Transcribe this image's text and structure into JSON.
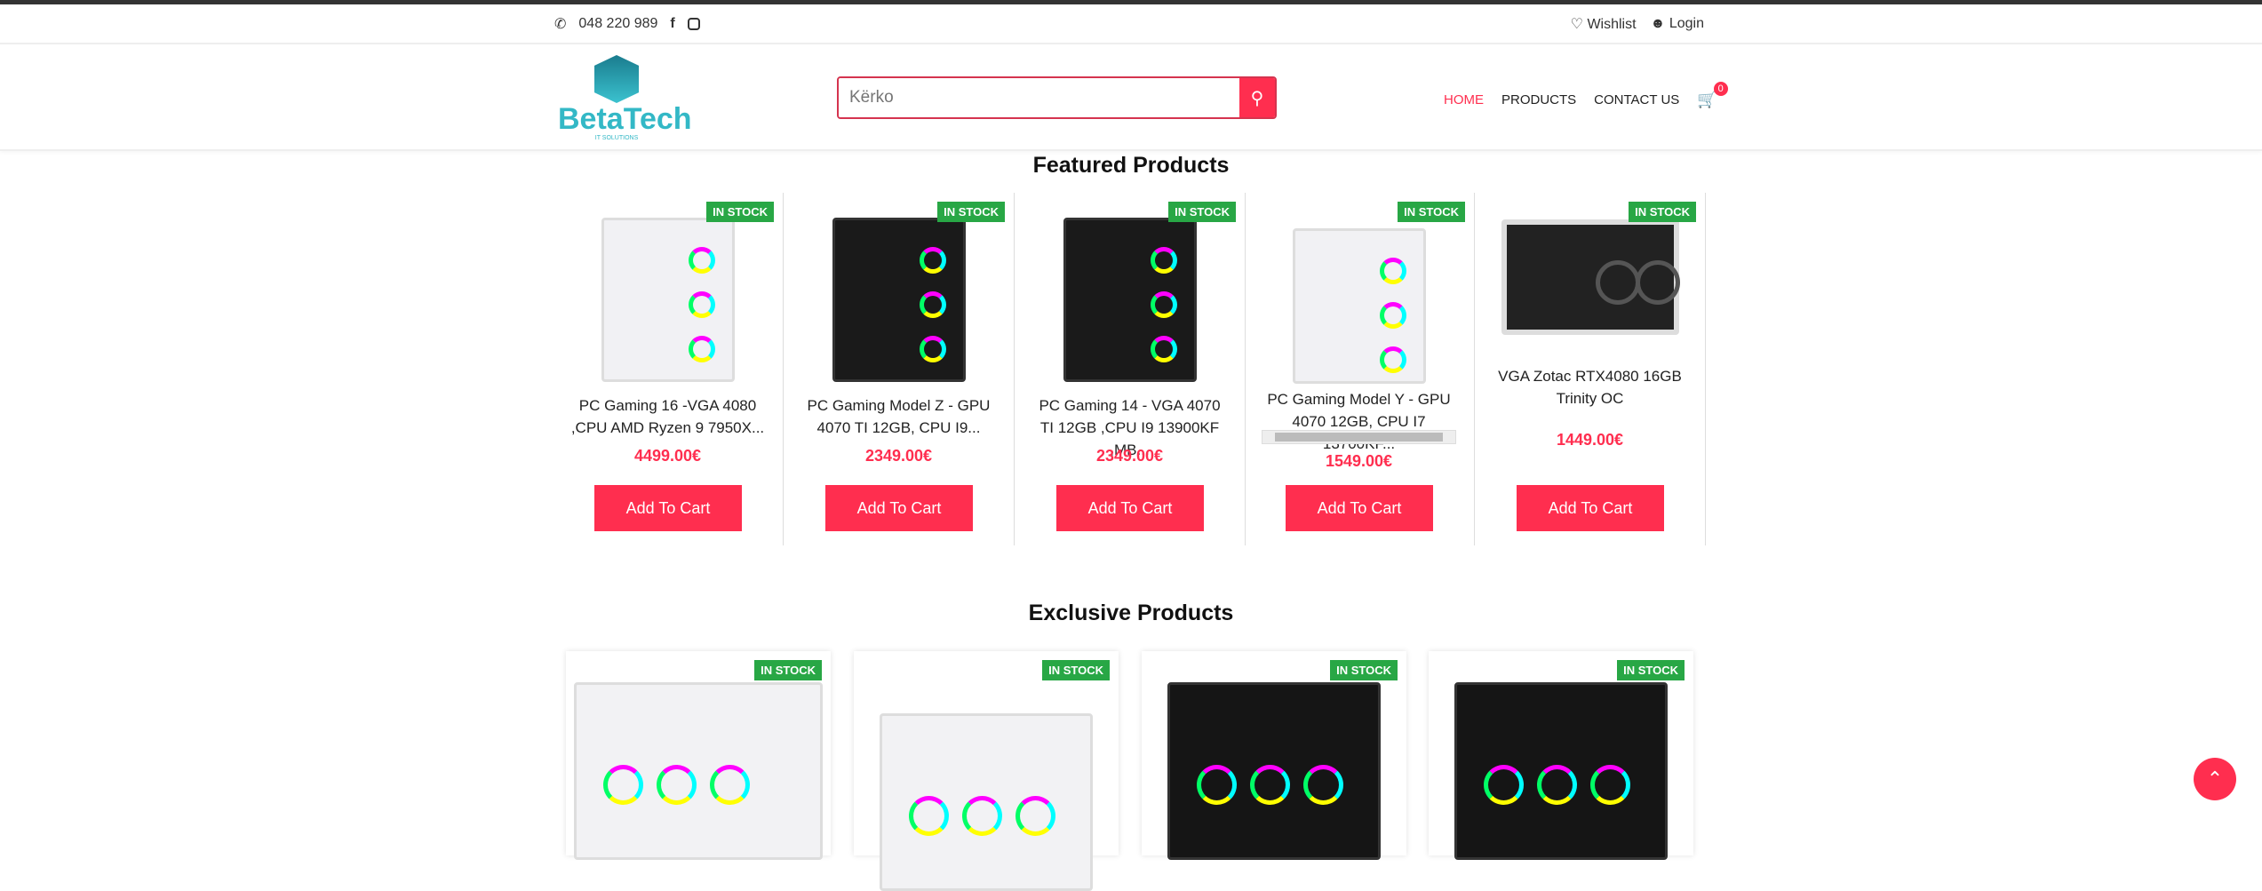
{
  "topbar": {
    "phone": "048 220 989",
    "wishlist": "Wishlist",
    "login": "Login"
  },
  "header": {
    "logo_name": "BetaTech",
    "logo_sub": "IT SOLUTIONS",
    "search_placeholder": "Kërko",
    "nav": [
      "HOME",
      "PRODUCTS",
      "CONTACT US"
    ],
    "cart_count": "0"
  },
  "featured": {
    "title": "Featured Products",
    "products": [
      {
        "name": "PC Gaming 16 -VGA 4080 ,CPU AMD Ryzen 9 7950X...",
        "price": "4499.00€",
        "stock": "IN STOCK",
        "button": "Add To Cart"
      },
      {
        "name": "PC Gaming Model Z - GPU 4070 TI 12GB, CPU I9...",
        "price": "2349.00€",
        "stock": "IN STOCK",
        "button": "Add To Cart"
      },
      {
        "name": "PC Gaming 14 - VGA 4070 TI 12GB ,CPU I9 13900KF ,MB...",
        "price": "2349.00€",
        "stock": "IN STOCK",
        "button": "Add To Cart"
      },
      {
        "name": "PC Gaming Model Y - GPU 4070 12GB, CPU I7 13700KF...",
        "price": "1549.00€",
        "stock": "IN STOCK",
        "button": "Add To Cart"
      },
      {
        "name": "VGA Zotac RTX4080 16GB Trinity OC",
        "price": "1449.00€",
        "stock": "IN STOCK",
        "button": "Add To Cart"
      }
    ]
  },
  "exclusive": {
    "title": "Exclusive Products",
    "products": [
      {
        "stock": "IN STOCK"
      },
      {
        "stock": "IN STOCK"
      },
      {
        "stock": "IN STOCK"
      },
      {
        "stock": "IN STOCK"
      }
    ]
  }
}
